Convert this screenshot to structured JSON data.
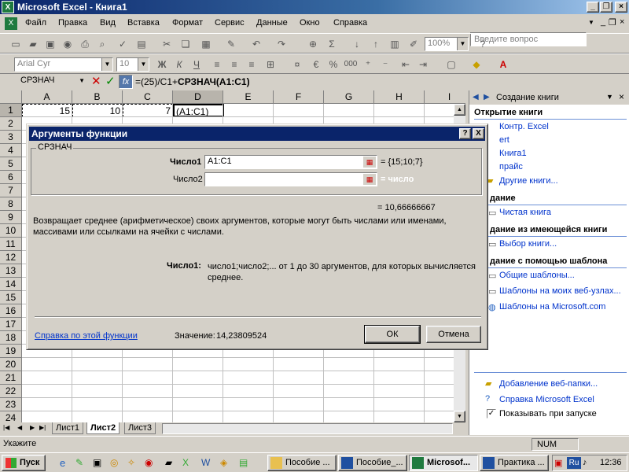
{
  "window": {
    "title": "Microsoft Excel - Книга1"
  },
  "menu": [
    "Файл",
    "Правка",
    "Вид",
    "Вставка",
    "Формат",
    "Сервис",
    "Данные",
    "Окно",
    "Справка"
  ],
  "help_box": {
    "placeholder": "Введите вопрос"
  },
  "toolbar": {
    "zoom": "100%",
    "font": "Arial Cyr",
    "size": "10",
    "bold": "Ж",
    "italic": "К",
    "underline": "Ч",
    "percent": "%",
    "thousands": "000"
  },
  "formula_bar": {
    "name_box": "СРЗНАЧ",
    "formula_prefix": "=(25)/C1+",
    "formula_bold": "СРЗНАЧ(A1:C1)"
  },
  "grid": {
    "columns": [
      "A",
      "B",
      "C",
      "D",
      "E",
      "F",
      "G",
      "H",
      "I"
    ],
    "rows": [
      "1",
      "2",
      "3",
      "4",
      "5",
      "6",
      "7",
      "8",
      "9",
      "10",
      "11",
      "12",
      "13",
      "14",
      "15",
      "16",
      "17",
      "18",
      "19",
      "20",
      "21",
      "22",
      "23",
      "24"
    ],
    "cells": {
      "A1": "15",
      "B1": "10",
      "C1": "7",
      "D1": "(A1:C1)"
    }
  },
  "sheet_tabs": [
    "Лист1",
    "Лист2",
    "Лист3"
  ],
  "active_sheet": "Лист2",
  "dialog": {
    "title": "Аргументы функции",
    "group_label": "СРЗНАЧ",
    "arg1_label": "Число1",
    "arg1_value": "A1:C1",
    "arg1_result": "= {15;10;7}",
    "arg2_label": "Число2",
    "arg2_value": "",
    "arg2_result": "= число",
    "total_result": "= 10,66666667",
    "description": "Возвращает среднее (арифметическое) своих аргументов, которые могут быть числами или именами, массивами или ссылками на ячейки с числами.",
    "arg_help_label": "Число1:",
    "arg_help_text": "число1;число2;... от 1 до 30 аргументов, для которых вычисляется среднее.",
    "help_link": "Справка по этой функции",
    "value_label": "Значение:",
    "value": "14,23809524",
    "ok": "ОК",
    "cancel": "Отмена",
    "help_btn": "?",
    "close_btn": "X"
  },
  "task_pane": {
    "title": "Создание книги",
    "open_header": "Открытие книги",
    "open_items": [
      "Контр. Excel",
      "ert",
      "Книга1",
      "прайс"
    ],
    "more_books": "Другие книги...",
    "new_header": "дание",
    "new_item": "Чистая книга",
    "from_existing_header": "дание из имеющейся книги",
    "from_existing_item": "Выбор книги...",
    "from_template_header": "дание с помощью шаблона",
    "template_items": [
      "Общие шаблоны...",
      "Шаблоны на моих веб-узлах...",
      "Шаблоны на Microsoft.com"
    ],
    "bottom_items": [
      "Добавление веб-папки...",
      "Справка Microsoft Excel"
    ],
    "show_at_startup": "Показывать при запуске"
  },
  "status_bar": {
    "text": "Укажите",
    "num": "NUM"
  },
  "taskbar": {
    "start": "Пуск",
    "tasks": [
      "Пособие ...",
      "Пособие_...",
      "Microsof...",
      "Практика ..."
    ],
    "lang": "Ru",
    "clock": "12:36"
  }
}
